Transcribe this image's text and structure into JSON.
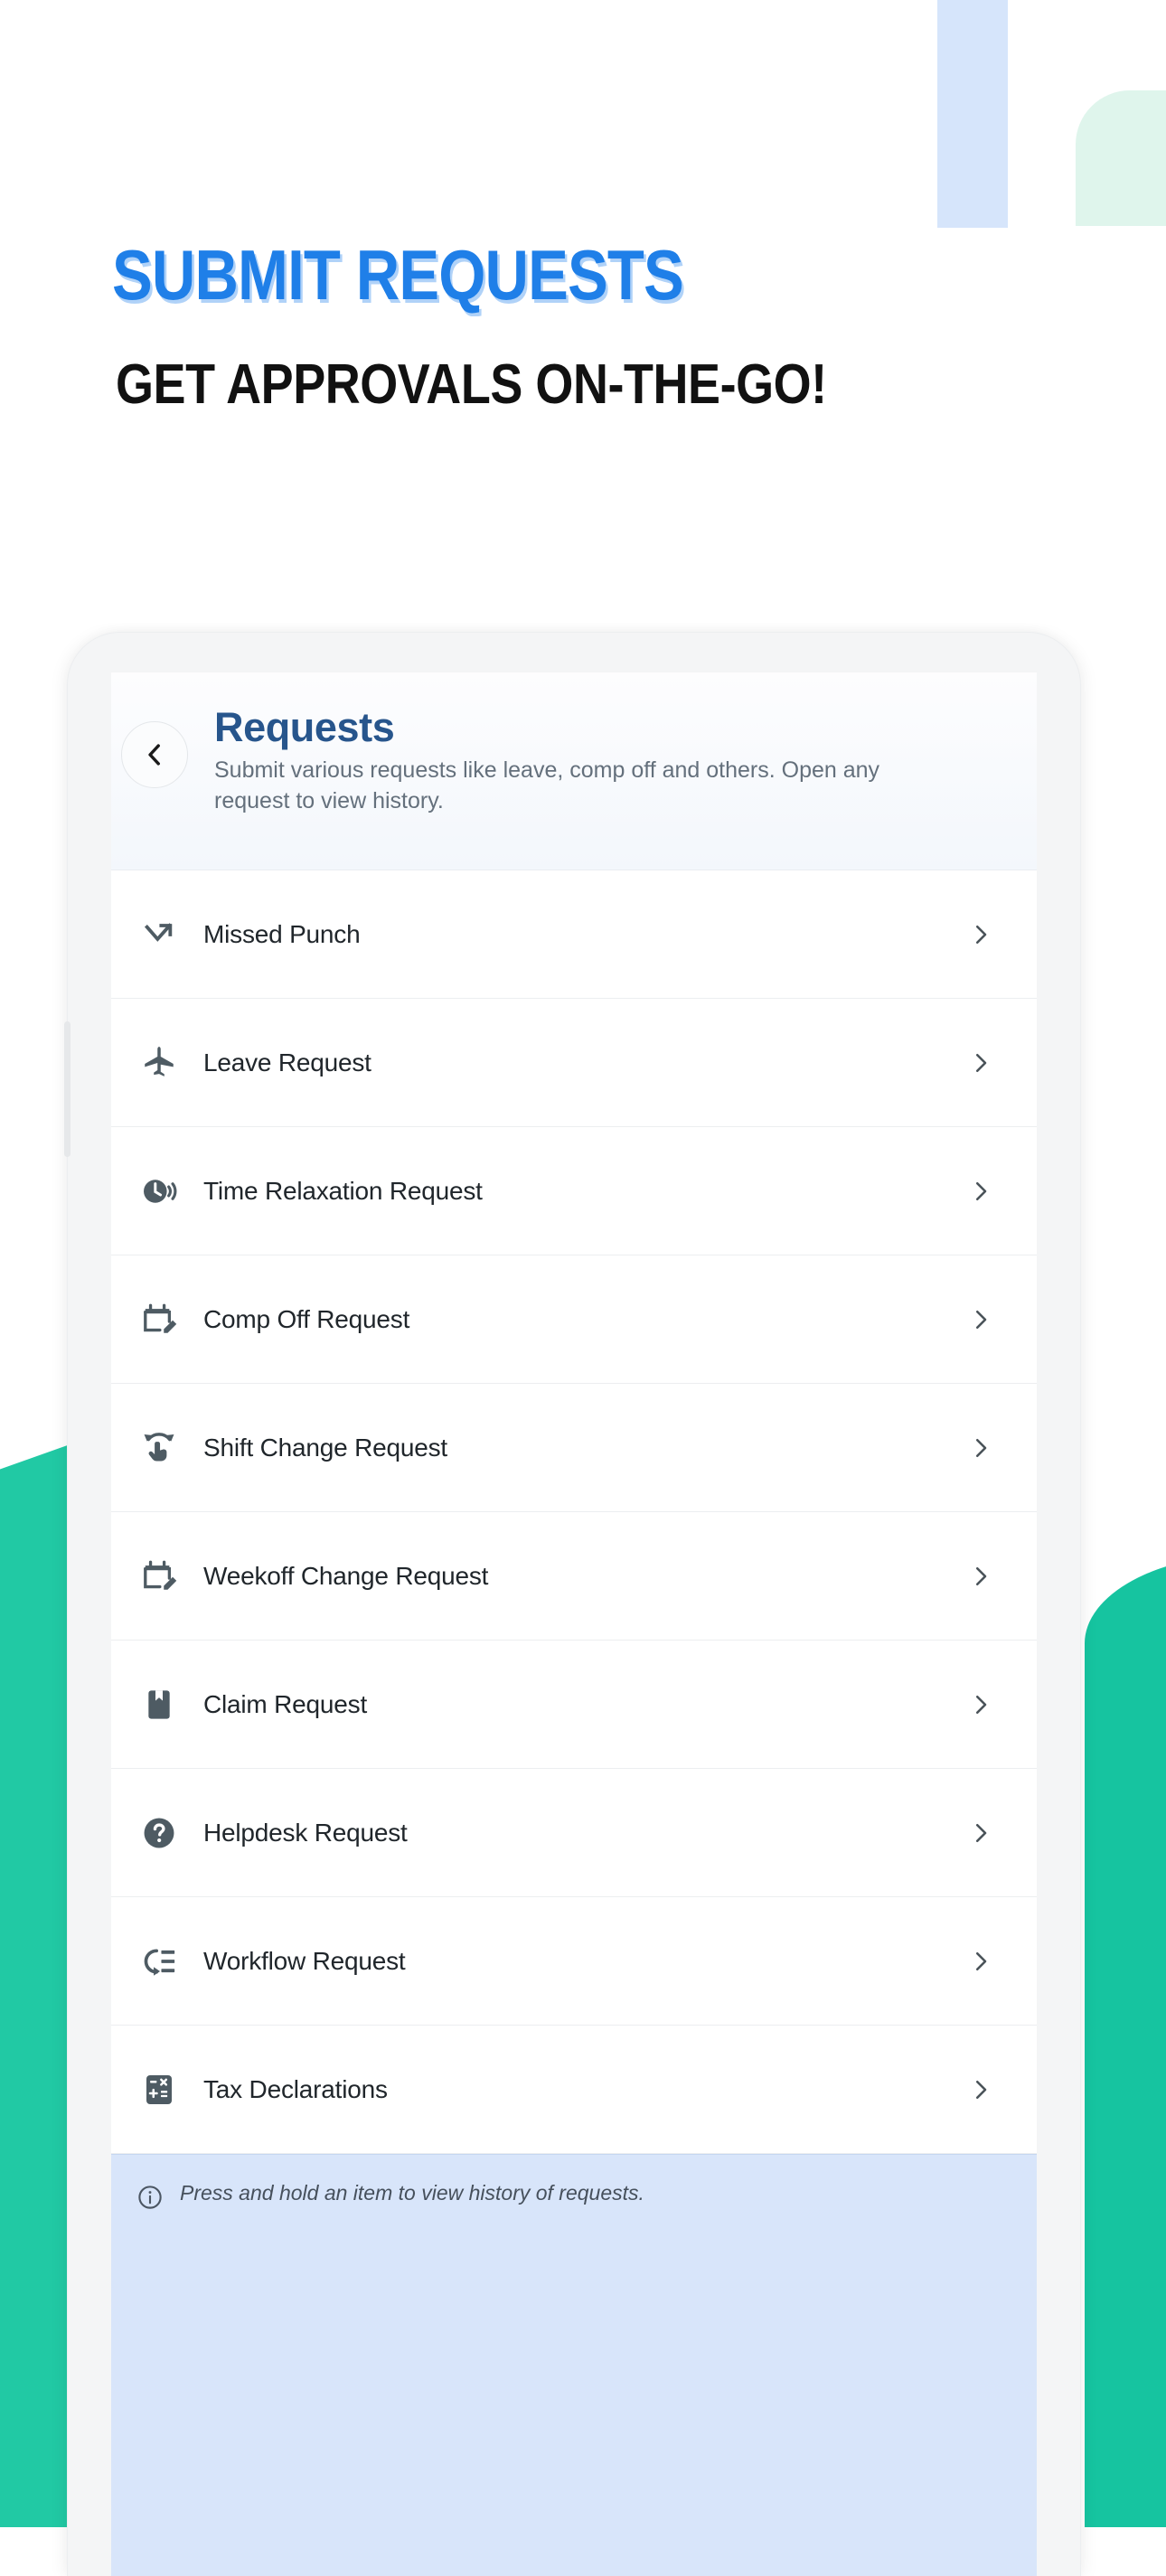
{
  "poster": {
    "title": "SUBMIT REQUESTS",
    "subtitle": "GET APPROVALS ON-THE-GO!",
    "title_color": "#1f7fe8",
    "title_shadow_color": "#96c3f5",
    "subtitle_color": "#111111",
    "accent_teal": "#21c9a4",
    "accent_blue_pale": "#d6e5fb",
    "accent_mint": "#dff5ec"
  },
  "app": {
    "header": {
      "back_icon": "chevron-left-icon",
      "title": "Requests",
      "title_color": "#27558c",
      "subtitle": "Submit various requests like leave, comp off and others. Open any request to view history."
    },
    "list": [
      {
        "icon": "missed-punch-arrow-icon",
        "label": "Missed Punch",
        "chevron": "chevron-right-icon"
      },
      {
        "icon": "airplane-icon",
        "label": "Leave Request",
        "chevron": "chevron-right-icon"
      },
      {
        "icon": "clock-sound-icon",
        "label": "Time Relaxation Request",
        "chevron": "chevron-right-icon"
      },
      {
        "icon": "calendar-edit-icon",
        "label": "Comp Off Request",
        "chevron": "chevron-right-icon"
      },
      {
        "icon": "hand-swap-icon",
        "label": "Shift Change Request",
        "chevron": "chevron-right-icon"
      },
      {
        "icon": "calendar-edit-icon",
        "label": "Weekoff Change Request",
        "chevron": "chevron-right-icon"
      },
      {
        "icon": "bookmark-book-icon",
        "label": "Claim Request",
        "chevron": "chevron-right-icon"
      },
      {
        "icon": "question-circle-icon",
        "label": "Helpdesk Request",
        "chevron": "chevron-right-icon"
      },
      {
        "icon": "workflow-list-icon",
        "label": "Workflow Request",
        "chevron": "chevron-right-icon"
      },
      {
        "icon": "calculator-icon",
        "label": "Tax Declarations",
        "chevron": "chevron-right-icon"
      }
    ],
    "note": {
      "icon": "info-circle-icon",
      "text": "Press and hold an item to view history of requests.",
      "background": "#d8e5fa"
    }
  }
}
